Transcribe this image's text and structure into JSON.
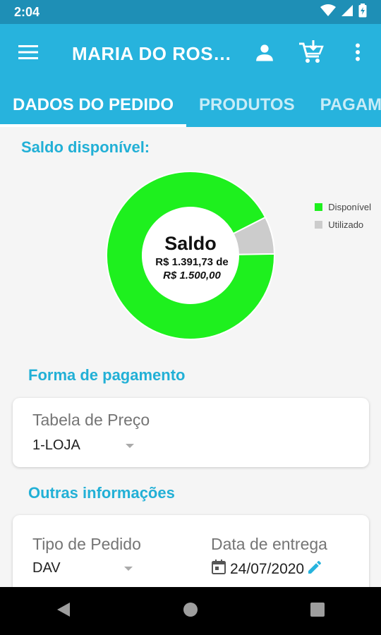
{
  "status_bar": {
    "time": "2:04",
    "icons": [
      "wifi-icon",
      "signal-icon",
      "battery-icon"
    ]
  },
  "app_bar": {
    "title": "MARIA DO ROS…",
    "actions": [
      "person-icon",
      "cart-download-icon",
      "more-vert-icon"
    ]
  },
  "tabs": [
    {
      "label": "DADOS DO PEDIDO",
      "active": true
    },
    {
      "label": "PRODUTOS",
      "active": false
    },
    {
      "label": "PAGAMEN",
      "active": false
    }
  ],
  "saldo": {
    "title": "Saldo disponível:",
    "center_title": "Saldo",
    "center_line1": "R$  1.391,73 de",
    "center_line2": "R$  1.500,00"
  },
  "chart_data": {
    "type": "pie",
    "donut": true,
    "categories": [
      "Disponível",
      "Utilizado"
    ],
    "values": [
      1391.73,
      108.27
    ],
    "colors": [
      "#1ef01e",
      "#cccccc"
    ],
    "legend_position": "top-right"
  },
  "forma_pagamento": {
    "title": "Forma de pagamento",
    "tabela_label": "Tabela de Preço",
    "tabela_value": "1-LOJA"
  },
  "outras_info": {
    "title": "Outras informações",
    "tipo_label": "Tipo de Pedido",
    "tipo_value": "DAV",
    "data_label": "Data de entrega",
    "data_value": "24/07/2020"
  },
  "colors": {
    "primary": "#27b3dd",
    "status": "#1e8fb6",
    "accent_text": "#22b0d6"
  }
}
